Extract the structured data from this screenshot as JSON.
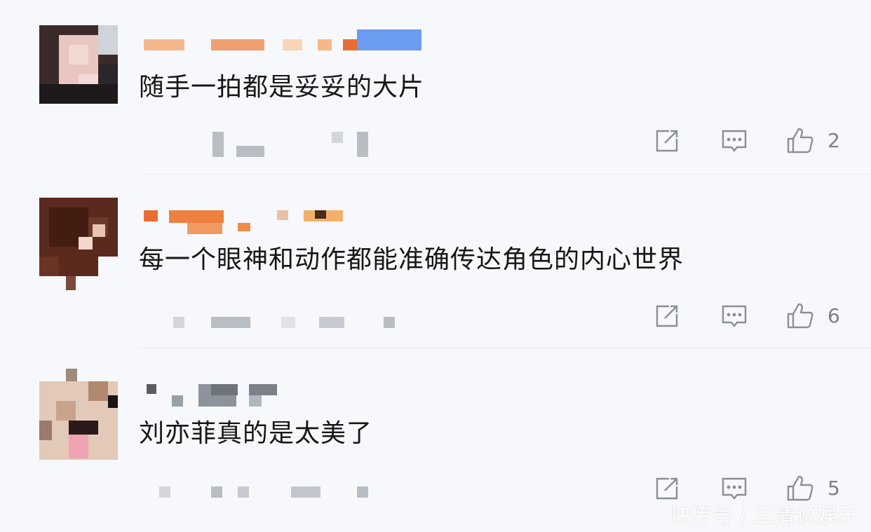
{
  "comments": [
    {
      "text": "随手一拍都是妥妥的大片",
      "likes": "2"
    },
    {
      "text": "每一个眼神和动作都能准确传达角色的内心世界",
      "likes": "6"
    },
    {
      "text": "刘亦菲真的是太美了",
      "likes": "5"
    }
  ],
  "watermark": "快传号 / 三清说娱乐",
  "colors": {
    "text": "#161616",
    "icon": "#8a8f97",
    "count": "#7b8088"
  }
}
